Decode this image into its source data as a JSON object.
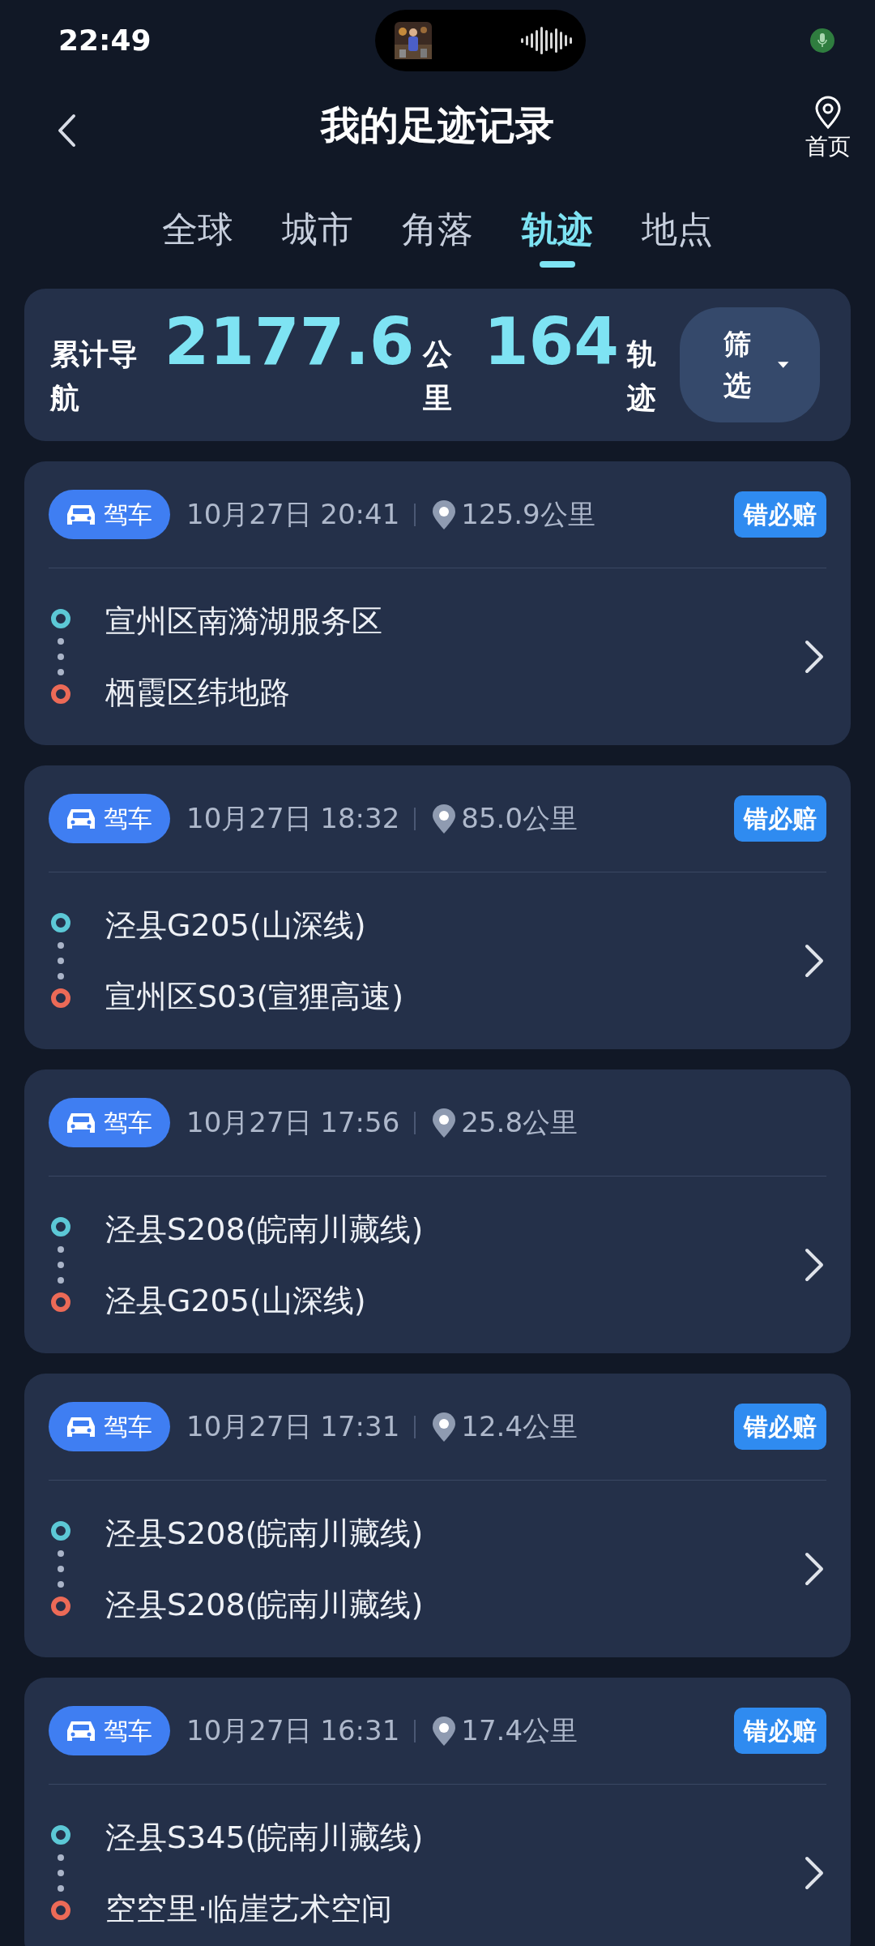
{
  "status_bar": {
    "time": "22:49"
  },
  "header": {
    "title": "我的足迹记录",
    "home_label": "首页"
  },
  "tabs": [
    {
      "label": "全球",
      "selected": false
    },
    {
      "label": "城市",
      "selected": false
    },
    {
      "label": "角落",
      "selected": false
    },
    {
      "label": "轨迹",
      "selected": true
    },
    {
      "label": "地点",
      "selected": false
    }
  ],
  "summary": {
    "label": "累计导航",
    "distance": "2177.6",
    "distance_unit": "公里",
    "tracks": "164",
    "tracks_unit": "轨迹",
    "filter_label": "筛选"
  },
  "trips": [
    {
      "mode": "驾车",
      "time": "10月27日 20:41",
      "distance": "125.9公里",
      "badge": "错必赔",
      "start": "宣州区南漪湖服务区",
      "end": "栖霞区纬地路"
    },
    {
      "mode": "驾车",
      "time": "10月27日 18:32",
      "distance": "85.0公里",
      "badge": "错必赔",
      "start": "泾县G205(山深线)",
      "end": "宣州区S03(宣狸高速)"
    },
    {
      "mode": "驾车",
      "time": "10月27日 17:56",
      "distance": "25.8公里",
      "start": "泾县S208(皖南川藏线)",
      "end": "泾县G205(山深线)"
    },
    {
      "mode": "驾车",
      "time": "10月27日 17:31",
      "distance": "12.4公里",
      "badge": "错必赔",
      "start": "泾县S208(皖南川藏线)",
      "end": "泾县S208(皖南川藏线)"
    },
    {
      "mode": "驾车",
      "time": "10月27日 16:31",
      "distance": "17.4公里",
      "badge": "错必赔",
      "start": "泾县S345(皖南川藏线)",
      "end": "空空里·临崖艺术空间"
    }
  ]
}
